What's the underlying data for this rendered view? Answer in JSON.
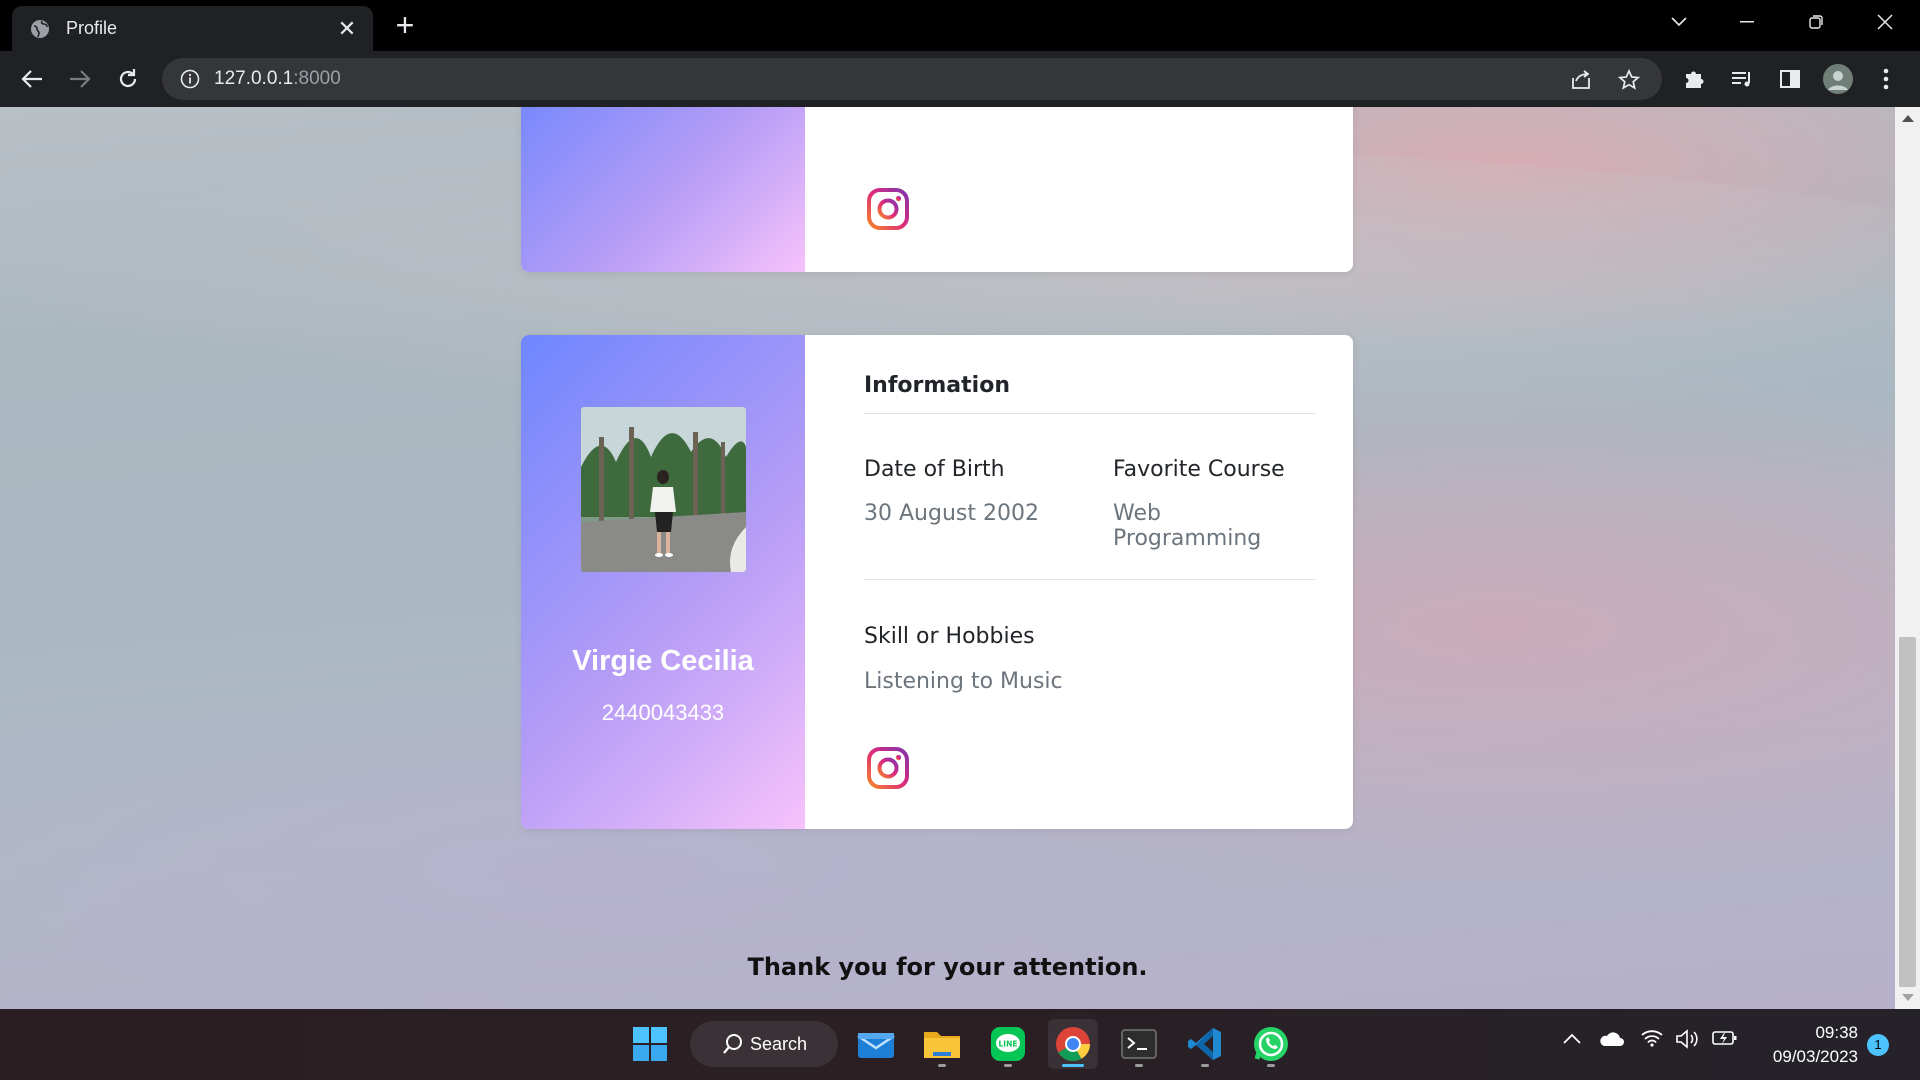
{
  "browser": {
    "tab_title": "Profile",
    "url_host": "127.0.0.1",
    "url_port": ":8000"
  },
  "profile": {
    "name": "Virgie Cecilia",
    "student_id": "2440043433",
    "info_heading": "Information",
    "dob_label": "Date of Birth",
    "dob_value": "30 August 2002",
    "course_label": "Favorite Course",
    "course_value": "Web Programming",
    "hobbies_label": "Skill or Hobbies",
    "hobbies_value": "Listening to Music"
  },
  "footer": {
    "thanks": "Thank you for your attention."
  },
  "taskbar": {
    "search_label": "Search",
    "time": "09:38",
    "date": "09/03/2023",
    "notification_count": "1"
  },
  "colors": {
    "side_gradient_start": "#6f86ff",
    "side_gradient_end": "#f6c2fb",
    "accent_blue": "#4cc2ff"
  }
}
